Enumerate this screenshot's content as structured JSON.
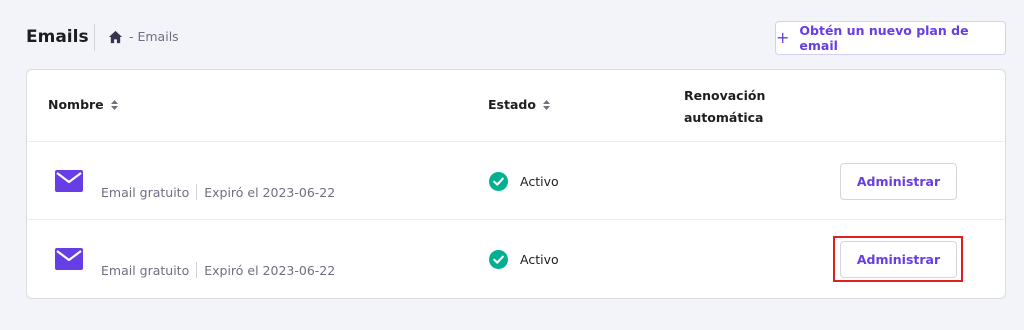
{
  "header": {
    "title": "Emails",
    "breadcrumb": "- Emails",
    "cta_plus": "+",
    "cta_label": "Obtén un nuevo plan de email"
  },
  "table": {
    "columns": {
      "name": "Nombre",
      "state": "Estado",
      "renewal_line1": "Renovación",
      "renewal_line2": "automática"
    },
    "rows": [
      {
        "plan": "Email gratuito",
        "expiry": "Expiró el 2023-06-22",
        "status": "Activo",
        "action": "Administrar"
      },
      {
        "plan": "Email gratuito",
        "expiry": "Expiró el 2023-06-22",
        "status": "Activo",
        "action": "Administrar"
      }
    ]
  },
  "colors": {
    "accent": "#673de6",
    "status_ok": "#00b090",
    "highlight": "#e02020"
  },
  "icons": [
    "home-icon",
    "sort-icon",
    "mail-icon",
    "check-circle-icon"
  ]
}
